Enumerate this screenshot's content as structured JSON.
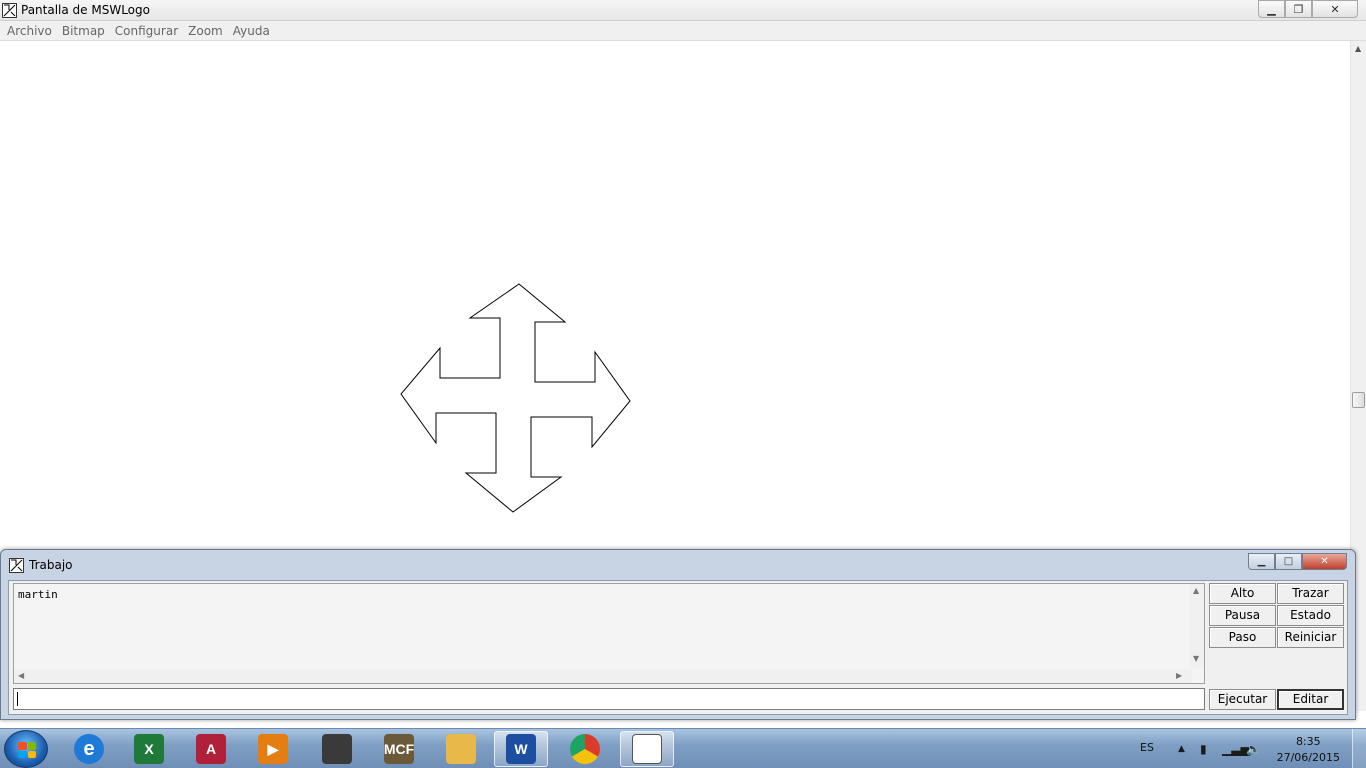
{
  "window": {
    "title": "Pantalla de MSWLogo",
    "min_glyph": "▁",
    "max_glyph": "❐",
    "close_glyph": "✕"
  },
  "menu": {
    "items": [
      "Archivo",
      "Bitmap",
      "Configurar",
      "Zoom",
      "Ayuda"
    ]
  },
  "canvas": {
    "drawing": "arrow-cross-outline"
  },
  "trabajo": {
    "title": "Trabajo",
    "min_glyph": "▁",
    "max_glyph": "□",
    "close_glyph": "✕",
    "history": "martin",
    "command_value": "",
    "buttons": {
      "alto": "Alto",
      "trazar": "Trazar",
      "pausa": "Pausa",
      "estado": "Estado",
      "paso": "Paso",
      "reiniciar": "Reiniciar",
      "ejecutar": "Ejecutar",
      "editar": "Editar"
    }
  },
  "taskbar": {
    "apps": [
      {
        "icon": "internet-explorer-icon",
        "label": "e",
        "color": "#1e7ad6"
      },
      {
        "icon": "excel-icon",
        "label": "X",
        "color": "#1f7a3a"
      },
      {
        "icon": "access-icon",
        "label": "A",
        "color": "#b0203a"
      },
      {
        "icon": "media-player-icon",
        "label": "▶",
        "color": "#e57e12"
      },
      {
        "icon": "game-icon",
        "label": "",
        "color": "#3a3a3a"
      },
      {
        "icon": "mcf-icon",
        "label": "MCF",
        "color": "#6b5a3a"
      },
      {
        "icon": "file-explorer-icon",
        "label": "",
        "color": "#e8b84a"
      },
      {
        "icon": "word-icon",
        "label": "W",
        "color": "#1d4fa0"
      },
      {
        "icon": "chrome-icon",
        "label": "",
        "color": "#dd3b2a"
      },
      {
        "icon": "mswlogo-icon",
        "label": "",
        "color": "#ffffff"
      }
    ],
    "language": "ES",
    "time": "8:35",
    "date": "27/06/2015"
  }
}
